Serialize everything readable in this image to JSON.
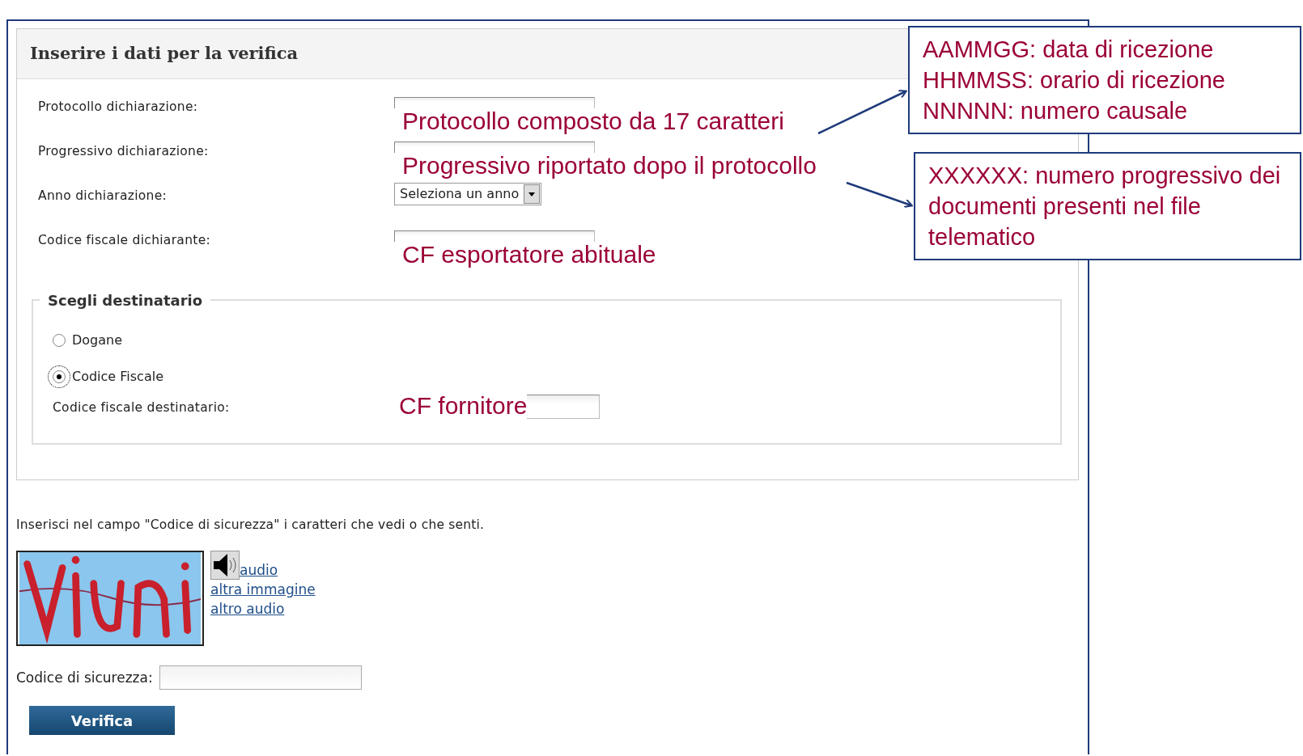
{
  "panel": {
    "title": "Inserire i dati per la verifica"
  },
  "fields": [
    {
      "kind": "text",
      "label": "Protocollo dichiarazione:",
      "note": "Protocollo composto da 17 caratteri"
    },
    {
      "kind": "text",
      "label": "Progressivo dichiarazione:",
      "note": "Progressivo riportato dopo il protocollo"
    },
    {
      "kind": "select",
      "label": "Anno dichiarazione:",
      "value": "Seleziona un anno"
    },
    {
      "kind": "text",
      "label": "Codice fiscale dichiarante:",
      "note": "CF esportatore abituale"
    }
  ],
  "recipient": {
    "legend": "Scegli destinatario",
    "options": [
      {
        "label": "Dogane",
        "selected": false
      },
      {
        "label": "Codice Fiscale",
        "selected": true
      }
    ],
    "field": {
      "label": "Codice fiscale destinatario:",
      "note": "CF fornitore"
    }
  },
  "captcha": {
    "instructions": "Inserisci nel campo \"Codice di sicurezza\" i caratteri che vedi o che senti.",
    "audio_link": "audio",
    "links": [
      "altra immagine",
      "altro audio"
    ],
    "field_label": "Codice di sicurezza:"
  },
  "button": "Verifica",
  "callouts": [
    {
      "lines": [
        "AAMMGG: data di ricezione",
        "HHMMSS: orario di ricezione",
        "NNNNN: numero causale"
      ]
    },
    {
      "lines": [
        "XXXXXX: numero progressivo dei documenti presenti nel file telematico"
      ]
    }
  ]
}
